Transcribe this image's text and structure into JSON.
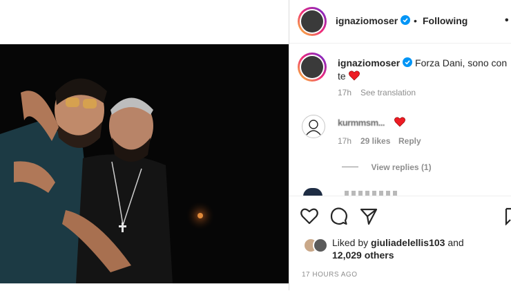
{
  "header": {
    "username": "ignaziomoser",
    "separator": "•",
    "follow_status": "Following",
    "more": "•"
  },
  "caption": {
    "username": "ignaziomoser",
    "text": "Forza Dani, sono con te",
    "emoji": "heart-red",
    "time": "17h",
    "translate": "See translation"
  },
  "comment": {
    "username": "kurmmsm...",
    "time": "17h",
    "likes": "29 likes",
    "reply": "Reply",
    "view_replies": "View replies (1)"
  },
  "likes": {
    "prefix": "Liked by",
    "user": "giuliadelellis103",
    "and": "and",
    "count": "12,029 others"
  },
  "timestamp": "17 HOURS AGO",
  "colors": {
    "heart": "#ed1c24",
    "verified": "#0095f6",
    "gray": "#8e8e8e"
  }
}
